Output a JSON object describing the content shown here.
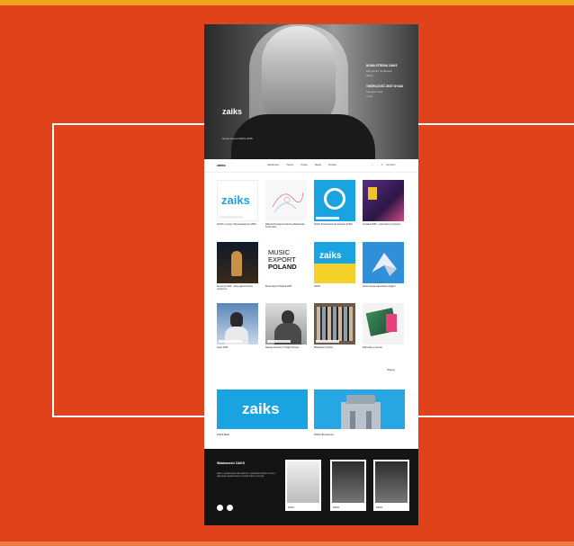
{
  "hero": {
    "logo": "zaiks",
    "caption": "Nowa strona ZAiKS 2025",
    "side_heading_1": "NOWA STRONA ZAIKS",
    "side_text_1": "Dla twórców i wydawców",
    "side_link_1": "Więcej →",
    "side_heading_2": "TWÓRCZOŚĆ JEST W NAS",
    "side_text_2": "Kampania 2025",
    "side_link_2": "Czytaj"
  },
  "nav": {
    "logo": "zaiks",
    "links": [
      "Aktualności",
      "Twórcy",
      "Prawa",
      "Media",
      "Kontakt"
    ],
    "lang": "English",
    "search_icon": "search-icon",
    "user_icon": "user-icon",
    "menu_icon": "menu-icon"
  },
  "cards": [
    {
      "title": "ZAiKS w nowym Streamingowym 2025 r.",
      "theme": "zaiks-logo"
    },
    {
      "title": "Wideoinformacja Funduszu Wspierania Twórczości",
      "theme": "sketch"
    },
    {
      "title": "ZAiKS Stowarzyszenie Autorów ZAiKS",
      "theme": "blue-circle"
    },
    {
      "title": "Festiwal 2025 - nowi twórcy i koncerty",
      "theme": "poster-purple"
    },
    {
      "title": "Koncerty 2025 - nowe gala koncerty muzyczne",
      "theme": "dark-photo"
    },
    {
      "title": "Music Export Poland 2025",
      "theme": "music-export"
    },
    {
      "title": "ZAiKS",
      "theme": "zaiks-yellow"
    },
    {
      "title": "Nowa edycja warsztatów origami",
      "theme": "paper-bird"
    },
    {
      "title": "Autor 2025",
      "theme": "portrait-blue"
    },
    {
      "title": "Skarga Autorów w Twojej Obronie",
      "theme": "portrait-bw"
    },
    {
      "title": "Biblioteka Cyfrowa",
      "theme": "shelves"
    },
    {
      "title": "Warsztaty w terenie",
      "theme": "book-pink"
    }
  ],
  "music_export_text": [
    "MUSIC",
    "EXPORT",
    "POLAND"
  ],
  "more_label": "Więcej",
  "banners": [
    {
      "logo": "zaiks",
      "title": "ZAiKS Bank"
    },
    {
      "title": "ZAiKS dla twórców"
    }
  ],
  "footer": {
    "title": "Wiadomości ZAiKS",
    "text": "Nasze wydawnictwo dla twórców i wydawców. Raport roczny i najnowsze wiadomości ze świata kultury i muzyki.",
    "posters": [
      {
        "caption": "ZAIKS",
        "style": "light"
      },
      {
        "caption": "ZAIKS",
        "style": "dark"
      },
      {
        "caption": "ZAIKS",
        "style": "dark"
      }
    ]
  },
  "colors": {
    "background": "#e0421a",
    "accent_top": "#f0a41e",
    "zaiks_blue": "#1aa3e1"
  }
}
